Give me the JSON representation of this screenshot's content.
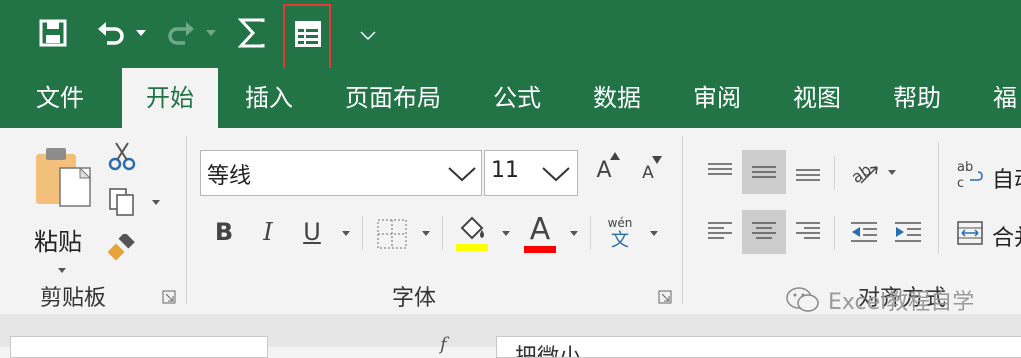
{
  "tabs": [
    "文件",
    "开始",
    "插入",
    "页面布局",
    "公式",
    "数据",
    "审阅",
    "视图",
    "帮助",
    "福"
  ],
  "font": {
    "name": "等线",
    "size": "11"
  },
  "buttons": {
    "paste": "粘贴",
    "bold": "B",
    "italic": "I",
    "underline": "U",
    "font_color": "A",
    "grow": "A",
    "shrink": "A",
    "phonetic_top": "wén",
    "phonetic_bottom": "文",
    "wrap_text": "自动",
    "merge": "合并"
  },
  "groups": {
    "clipboard": "剪贴板",
    "font": "字体",
    "alignment": "对齐方式"
  },
  "watermark": "Excel教程自学",
  "formula_bar": {
    "cell_content": "把微小"
  },
  "colors": {
    "excel_green": "#227447",
    "highlight": "#ffff00",
    "font_color": "#ff0000",
    "qat_highlight_box": "#e53935"
  }
}
